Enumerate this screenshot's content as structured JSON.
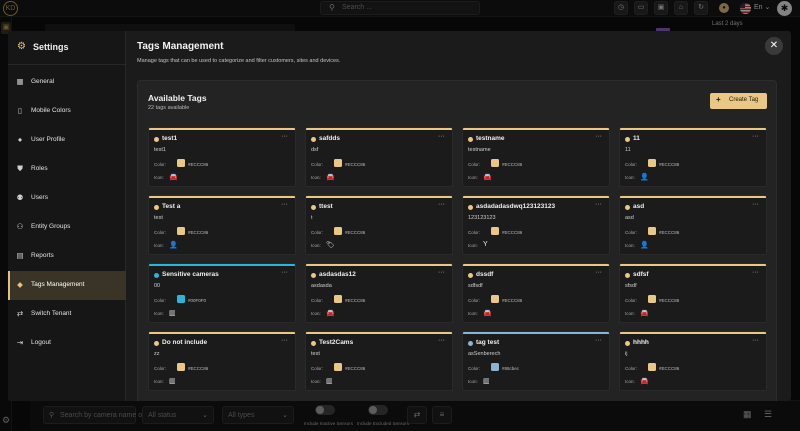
{
  "topbar": {
    "logo_text": "KD",
    "search_placeholder": "Search ...",
    "search_icon": "search-icon",
    "buttons": [
      "clock-icon",
      "monitor-icon",
      "user-card-icon",
      "home-icon",
      "refresh-icon"
    ],
    "language": "En",
    "accent_color": "#E9C785"
  },
  "background": {
    "date_range_label": "Last 2 days",
    "filter_search_placeholder": "Search by camera name or",
    "filter_status": "All status",
    "filter_types": "All types",
    "toggle_inactive": "Include Inactive Sensors",
    "toggle_excluded": "Include Excluded Sensors"
  },
  "settings": {
    "title": "Settings",
    "nav": [
      {
        "label": "General",
        "icon": "grid-icon",
        "icon_char": "▦",
        "active": false
      },
      {
        "label": "Mobile Colors",
        "icon": "phone-icon",
        "icon_char": "▯",
        "active": false
      },
      {
        "label": "User Profile",
        "icon": "person-icon",
        "icon_char": "●",
        "active": false
      },
      {
        "label": "Roles",
        "icon": "shield-icon",
        "icon_char": "⛊",
        "active": false
      },
      {
        "label": "Users",
        "icon": "users-icon",
        "icon_char": "⚉",
        "active": false
      },
      {
        "label": "Entity Groups",
        "icon": "entity-groups-icon",
        "icon_char": "⚇",
        "active": false
      },
      {
        "label": "Reports",
        "icon": "report-icon",
        "icon_char": "▤",
        "active": false
      },
      {
        "label": "Tags Management",
        "icon": "tag-icon",
        "icon_char": "◆",
        "active": true
      },
      {
        "label": "Switch Tenant",
        "icon": "switch-icon",
        "icon_char": "⇄",
        "active": false
      },
      {
        "label": "Logout",
        "icon": "logout-icon",
        "icon_char": "⇥",
        "active": false
      }
    ]
  },
  "tags_page": {
    "title": "Tags Management",
    "subtitle": "Manage tags that can be used to categorize and filter customers, sites and devices.",
    "panel_title": "Available Tags",
    "count_text": "22 tags available",
    "create_label": "Create Tag",
    "color_label": "Color:",
    "icon_label": "Icon:",
    "tags": [
      {
        "name": "test1",
        "desc": "test1",
        "color": "#E9C785",
        "hex": "#ECCC86",
        "icon": "car-icon",
        "icon_char": "🚘"
      },
      {
        "name": "safdds",
        "desc": "dsf",
        "color": "#E9C785",
        "hex": "#ECCC86",
        "icon": "car-icon",
        "icon_char": "🚘"
      },
      {
        "name": "testname",
        "desc": "testname",
        "color": "#E9C785",
        "hex": "#ECCC86",
        "icon": "car-icon",
        "icon_char": "🚘"
      },
      {
        "name": "11",
        "desc": "11",
        "color": "#E9C785",
        "hex": "#ECCC86",
        "icon": "person-icon",
        "icon_char": "👤"
      },
      {
        "name": "Test a",
        "desc": "test",
        "color": "#E9C785",
        "hex": "#ECCC86",
        "icon": "person-icon",
        "icon_char": "👤"
      },
      {
        "name": "ttest",
        "desc": "t",
        "color": "#E9C785",
        "hex": "#ECCC86",
        "icon": "tag-icon",
        "icon_char": "🏷"
      },
      {
        "name": "asdadadasdwq123123123",
        "desc": "123123123",
        "color": "#E9C785",
        "hex": "#ECCC86",
        "icon": "antenna-icon",
        "icon_char": "Y"
      },
      {
        "name": "asd",
        "desc": "asd",
        "color": "#E9C785",
        "hex": "#ECCC86",
        "icon": "person-icon",
        "icon_char": "👤"
      },
      {
        "name": "Sensitive cameras",
        "desc": "00",
        "color": "#29B6D8",
        "hex": "#00F0F0",
        "icon": "building-icon",
        "icon_char": "▥"
      },
      {
        "name": "asdasdas12",
        "desc": "asdasda",
        "color": "#E9C785",
        "hex": "#ECCC86",
        "icon": "car-icon",
        "icon_char": "🚘"
      },
      {
        "name": "dssdf",
        "desc": "sdfsdf",
        "color": "#E9C785",
        "hex": "#ECCC86",
        "icon": "car-icon",
        "icon_char": "🚘"
      },
      {
        "name": "sdfsf",
        "desc": "sfsdf",
        "color": "#E9C785",
        "hex": "#ECCC86",
        "icon": "car-icon",
        "icon_char": "🚘"
      },
      {
        "name": "Do not include",
        "desc": "zz",
        "color": "#E9C785",
        "hex": "#ECCC86",
        "icon": "building-icon",
        "icon_char": "▥"
      },
      {
        "name": "Test2Cams",
        "desc": "test",
        "color": "#E9C785",
        "hex": "#ECCC86",
        "icon": "building-icon",
        "icon_char": "▥"
      },
      {
        "name": "tag test",
        "desc": "asSenberech",
        "color": "#8CB4D4",
        "hex": "#88cbec",
        "icon": "building-icon",
        "icon_char": "▥"
      },
      {
        "name": "hhhh",
        "desc": "ij",
        "color": "#E9C785",
        "hex": "#ECCC86",
        "icon": "car-icon",
        "icon_char": "🚘"
      }
    ]
  }
}
